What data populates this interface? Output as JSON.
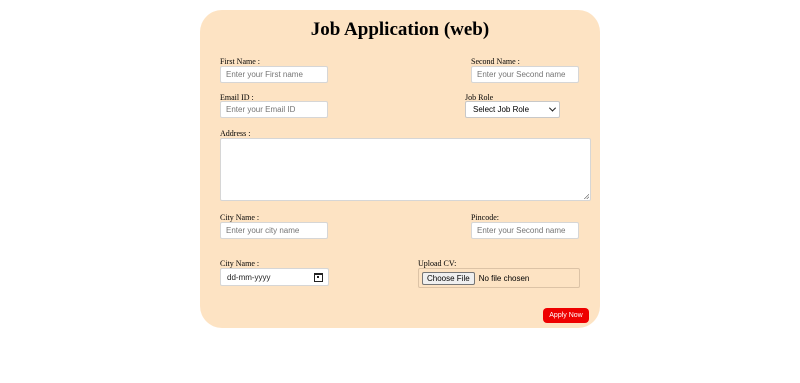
{
  "form": {
    "title": "Job Application (web)",
    "first_name": {
      "label": "First Name :",
      "placeholder": "Enter your First name"
    },
    "second_name": {
      "label": "Second Name :",
      "placeholder": "Enter your Second name"
    },
    "email": {
      "label": "Email ID :",
      "placeholder": "Enter your Email ID"
    },
    "job_role": {
      "label": "Job Role",
      "selected": "Select Job Role"
    },
    "address": {
      "label": "Address :"
    },
    "city": {
      "label": "City Name :",
      "placeholder": "Enter your city name"
    },
    "pincode": {
      "label": "Pincode:",
      "placeholder": "Enter your Second name"
    },
    "date": {
      "label": "City Name :",
      "placeholder": "dd-mm-yyyy"
    },
    "upload": {
      "label": "Upload CV:",
      "button": "Choose File",
      "status": "No file chosen"
    },
    "apply_label": "Apply Now"
  },
  "colors": {
    "card_background": "#fde3c3",
    "apply_button": "#ee0000"
  }
}
